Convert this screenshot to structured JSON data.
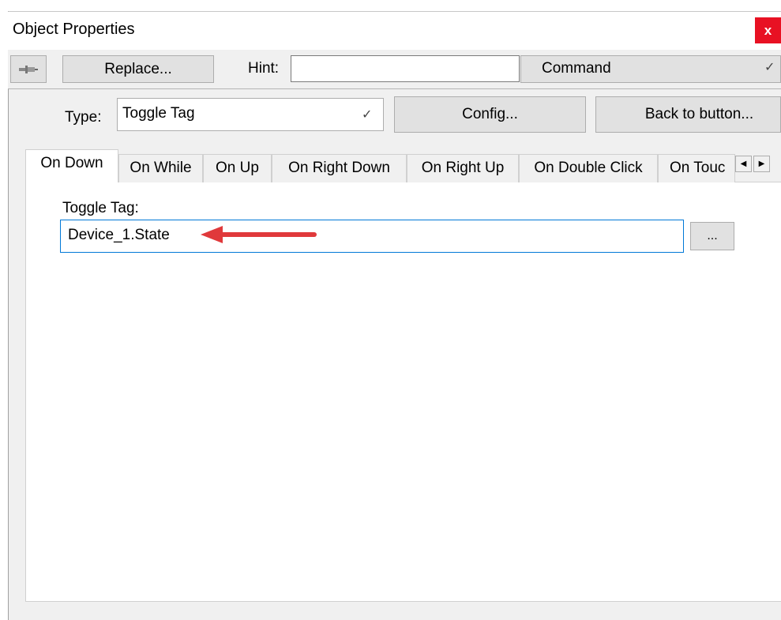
{
  "window": {
    "title": "Object Properties",
    "close_glyph": "x"
  },
  "toolbar": {
    "pin_icon": "pin-icon",
    "replace_label": "Replace...",
    "hint_label": "Hint:",
    "hint_value": "",
    "command_value": "Command"
  },
  "type_row": {
    "type_label": "Type:",
    "type_value": "Toggle Tag",
    "config_label": "Config...",
    "back_label": "Back to button..."
  },
  "tabs": [
    {
      "label": "On Down",
      "active": true
    },
    {
      "label": "On While",
      "active": false
    },
    {
      "label": "On Up",
      "active": false
    },
    {
      "label": "On Right Down",
      "active": false
    },
    {
      "label": "On Right Up",
      "active": false
    },
    {
      "label": "On Double Click",
      "active": false
    },
    {
      "label": "On Touc",
      "active": false
    }
  ],
  "content": {
    "field_label": "Toggle Tag:",
    "tag_value": "Device_1.State",
    "browse_label": "..."
  },
  "colors": {
    "accent": "#0078d7",
    "close": "#e81123",
    "annotation_arrow": "#e0393b"
  }
}
